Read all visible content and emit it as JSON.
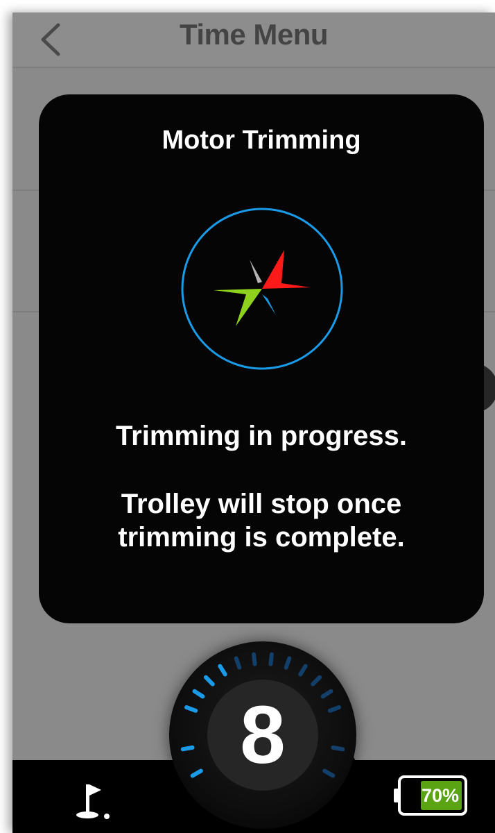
{
  "header": {
    "title": "Time Menu",
    "back_icon": "chevron-left-icon"
  },
  "modal": {
    "title": "Motor Trimming",
    "spinner_icon": "compass-star-icon",
    "message_line_1": "Trimming in progress.",
    "message_line_2": "Trolley will stop once trimming is complete."
  },
  "bottom_bar": {
    "speed_value": "8",
    "speed_level_fraction": 0.33,
    "golf_icon": "golf-flag-icon",
    "battery_icon": "battery-icon",
    "battery_label": "70%",
    "battery_level": 0.7
  },
  "colors": {
    "accent_blue": "#1a9be8",
    "star_red": "#ff1a1a",
    "star_green": "#8ed21e",
    "battery_green": "#5aa313"
  }
}
